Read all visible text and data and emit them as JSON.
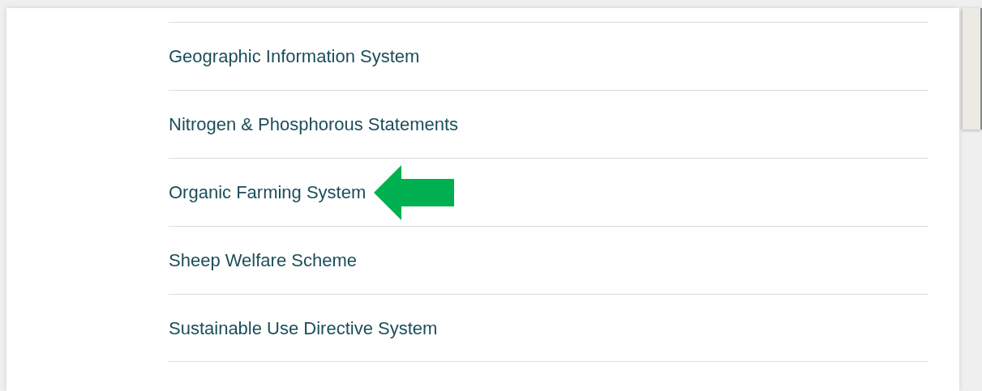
{
  "links": [
    {
      "label": "Geographic Information System",
      "highlighted": false
    },
    {
      "label": "Nitrogen & Phosphorous Statements",
      "highlighted": false
    },
    {
      "label": "Organic Farming System",
      "highlighted": true
    },
    {
      "label": "Sheep Welfare Scheme",
      "highlighted": false
    },
    {
      "label": "Sustainable Use Directive System",
      "highlighted": false
    }
  ]
}
